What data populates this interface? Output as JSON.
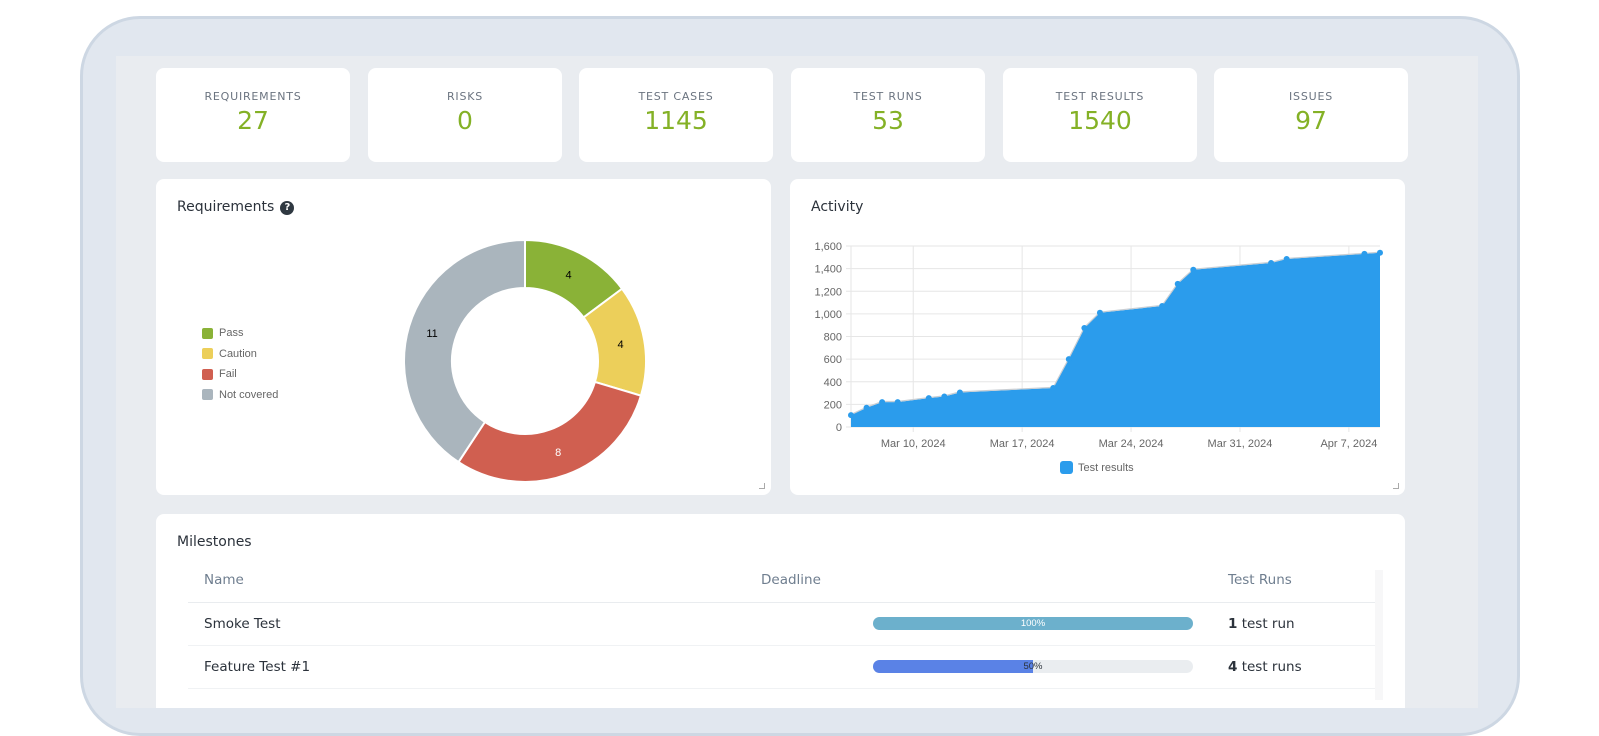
{
  "stats": [
    {
      "label": "REQUIREMENTS",
      "value": "27"
    },
    {
      "label": "RISKS",
      "value": "0"
    },
    {
      "label": "TEST CASES",
      "value": "1145"
    },
    {
      "label": "TEST RUNS",
      "value": "53"
    },
    {
      "label": "TEST RESULTS",
      "value": "1540"
    },
    {
      "label": "ISSUES",
      "value": "97"
    }
  ],
  "requirements_panel": {
    "title": "Requirements",
    "help_icon": "?"
  },
  "activity_panel": {
    "title": "Activity"
  },
  "chart_data": [
    {
      "type": "pie",
      "variant": "doughnut",
      "title": "Requirements",
      "labels": [
        "Pass",
        "Caution",
        "Fail",
        "Not covered"
      ],
      "values": [
        4,
        4,
        8,
        11
      ],
      "colors": [
        "#8ab237",
        "#eccf5a",
        "#d05f50",
        "#aab5bd"
      ],
      "legend": "left"
    },
    {
      "type": "area",
      "title": "Activity",
      "series": [
        {
          "name": "Test results",
          "color": "#2b9cec",
          "x": [
            "2024-03-06",
            "2024-03-07",
            "2024-03-08",
            "2024-03-09",
            "2024-03-11",
            "2024-03-12",
            "2024-03-13",
            "2024-03-19",
            "2024-03-20",
            "2024-03-21",
            "2024-03-22",
            "2024-03-26",
            "2024-03-27",
            "2024-03-28",
            "2024-04-02",
            "2024-04-03",
            "2024-04-08",
            "2024-04-09"
          ],
          "values": [
            105,
            170,
            220,
            220,
            255,
            270,
            305,
            345,
            600,
            875,
            1010,
            1070,
            1265,
            1390,
            1450,
            1485,
            1530,
            1540
          ]
        }
      ],
      "ylim": [
        0,
        1600
      ],
      "yticks": [
        "0",
        "200",
        "400",
        "600",
        "800",
        "1,000",
        "1,200",
        "1,400",
        "1,600"
      ],
      "xticks": [
        {
          "date": "2024-03-10",
          "label": "Mar 10, 2024"
        },
        {
          "date": "2024-03-17",
          "label": "Mar 17, 2024"
        },
        {
          "date": "2024-03-24",
          "label": "Mar 24, 2024"
        },
        {
          "date": "2024-03-31",
          "label": "Mar 31, 2024"
        },
        {
          "date": "2024-04-07",
          "label": "Apr 7, 2024"
        }
      ],
      "xrange": [
        "2024-03-06",
        "2024-04-09"
      ],
      "grid": true,
      "legend": "bottom"
    }
  ],
  "milestones": {
    "title": "Milestones",
    "columns": [
      "Name",
      "Deadline",
      "Test Runs"
    ],
    "rows": [
      {
        "name": "Smoke Test",
        "progress": 100,
        "progress_label": "100%",
        "progress_color": "#6cb0cc",
        "runs_count": "1",
        "runs_label": "test run"
      },
      {
        "name": "Feature Test #1",
        "progress": 50,
        "progress_label": "50%",
        "progress_color": "#5a82e6",
        "runs_count": "4",
        "runs_label": "test runs"
      }
    ]
  }
}
